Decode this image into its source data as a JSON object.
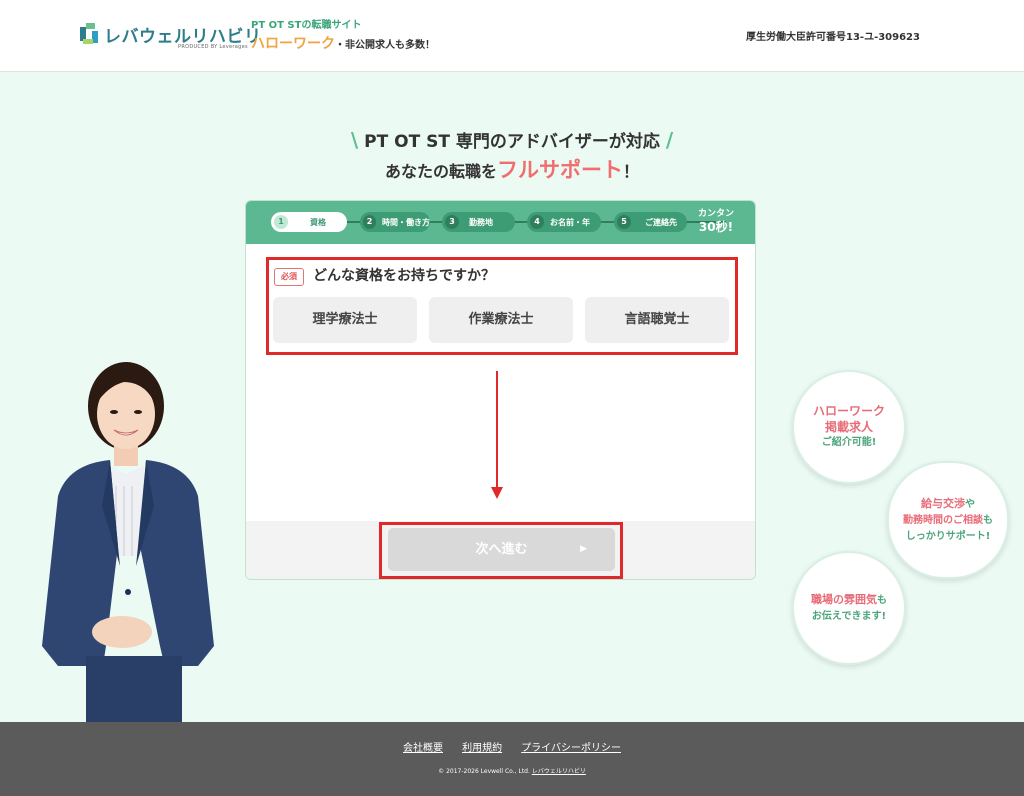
{
  "header": {
    "logo_text": "レバウェルリハビリ",
    "logo_sub": "PRODUCED BY Leverages",
    "tagline_top": "PT OT STの転職サイト",
    "tagline_highlight": "ハローワーク",
    "tagline_rest": "・非公開求人も多数！",
    "license": "厚生労働大臣許可番号13-ユ-309623"
  },
  "hero": {
    "line1": "PT OT ST 専門のアドバイザーが対応",
    "line2_pre": "あなたの転職を",
    "line2_accent": "フルサポート",
    "line2_post": "！"
  },
  "steps": [
    {
      "num": "1",
      "label": "資格"
    },
    {
      "num": "2",
      "label": "時間・働き方"
    },
    {
      "num": "3",
      "label": "勤務地"
    },
    {
      "num": "4",
      "label": "お名前・年"
    },
    {
      "num": "5",
      "label": "ご連絡先"
    }
  ],
  "kantan": {
    "line1": "カンタン",
    "line2": "30秒!"
  },
  "form": {
    "required_label": "必須",
    "question": "どんな資格をお持ちですか？",
    "options": [
      "理学療法士",
      "作業療法士",
      "言語聴覚士"
    ],
    "next_label": "次へ進む"
  },
  "bubbles": [
    {
      "l1": "ハローワーク",
      "l2": "掲載求人",
      "l3": "ご紹介可能!"
    },
    {
      "l1": "給与交渉",
      "l1b": "や",
      "l2": "勤務時間のご相談",
      "l2b": "も",
      "l3": "しっかりサポート!"
    },
    {
      "l1": "職場の雰囲気",
      "l1b": "も",
      "l2": "お伝えできます!"
    }
  ],
  "footer": {
    "links": [
      "会社概要",
      "利用規約",
      "プライバシーポリシー"
    ],
    "copyright": "© 2017-2026 Levwell Co., Ltd.",
    "copyright_link": "レバウェルリハビリ"
  },
  "colors": {
    "brand_green": "#5cb891",
    "accent_pink": "#f06e6e",
    "highlight_orange": "#f0a33e",
    "annotation_red": "#e02a2a"
  }
}
